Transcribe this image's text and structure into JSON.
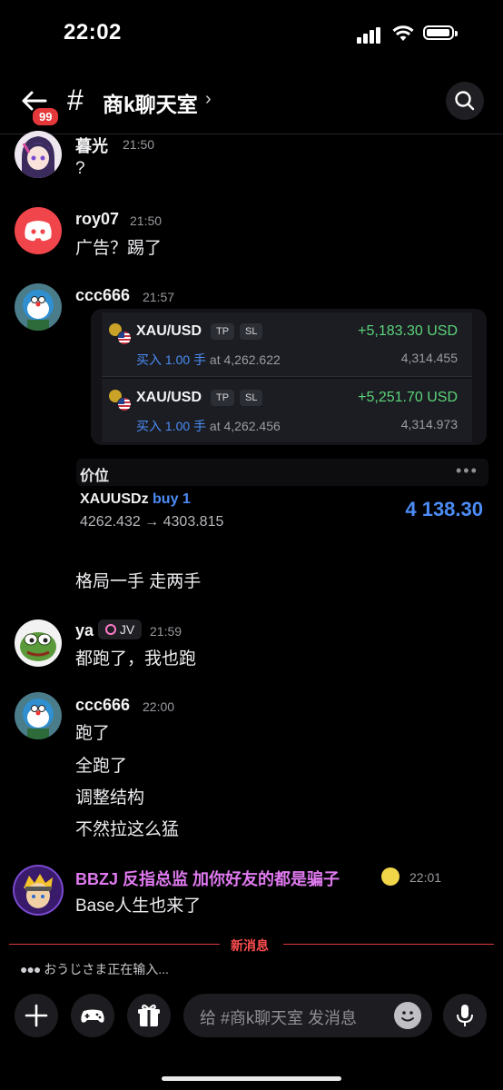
{
  "status_bar": {
    "time": "22:02"
  },
  "header": {
    "badge": "99",
    "hash": "#",
    "title": "商k聊天室",
    "chevron": "›"
  },
  "messages": [
    {
      "user": "暮光",
      "time": "21:50",
      "lines": [
        "?"
      ]
    },
    {
      "user": "roy07",
      "time": "21:50",
      "lines": [
        "广告？踢了"
      ]
    },
    {
      "user": "ccc666",
      "time": "21:57",
      "lines": [
        "格局一手 走两手"
      ]
    },
    {
      "user": "ya",
      "time": "21:59",
      "role": "JV",
      "lines": [
        "都跑了，我也跑"
      ]
    },
    {
      "user": "ccc666",
      "time": "22:00",
      "lines": [
        "跑了",
        "全跑了",
        "调整结构",
        "不然拉这么猛"
      ]
    },
    {
      "user": "BBZJ 反指总监 加你好友的都是骗子",
      "time": "22:01",
      "lines": [
        "Base人生也来了"
      ]
    }
  ],
  "trades": [
    {
      "symbol": "XAU/USD",
      "tp": "TP",
      "sl": "SL",
      "pnl": "+5,183.30 USD",
      "side": "买入",
      "qty": "1.00 手",
      "at": "at",
      "entry": "4,262.622",
      "current": "4,314.455"
    },
    {
      "symbol": "XAU/USD",
      "tp": "TP",
      "sl": "SL",
      "pnl": "+5,251.70 USD",
      "side": "买入",
      "qty": "1.00 手",
      "at": "at",
      "entry": "4,262.456",
      "current": "4,314.973"
    }
  ],
  "price_block": {
    "label": "价位",
    "dots": "•••",
    "symbol": "XAUUSDz",
    "action": "buy 1",
    "range": "4262.432 → 4303.815",
    "price": "4 138.30"
  },
  "new_messages_label": "新消息",
  "typing_indicator": "おうじさま正在输入...",
  "composer": {
    "placeholder": "给 #商k聊天室 发消息"
  },
  "colors": {
    "accent_blue": "#4c8cf5",
    "profit_green": "#5bd47a",
    "alert_red": "#e5383b",
    "highlight_name": "#e07af0"
  }
}
